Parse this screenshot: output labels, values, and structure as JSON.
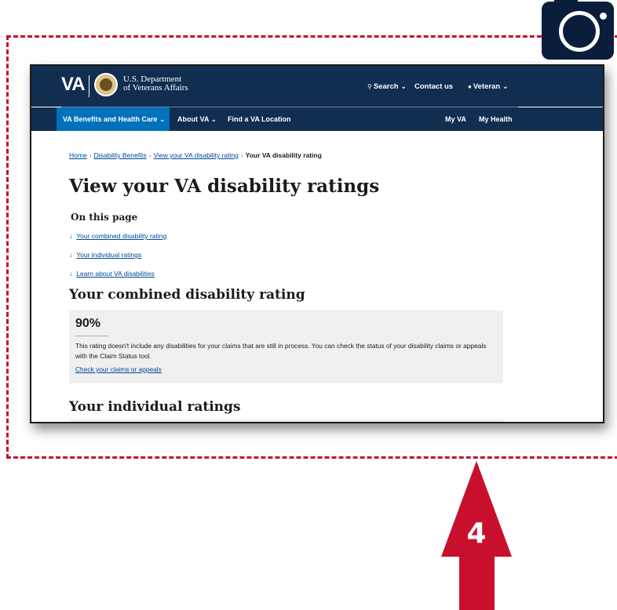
{
  "header": {
    "logo": "VA",
    "dept_line1": "U.S. Department",
    "dept_line2": "of Veterans Affairs",
    "search": "Search",
    "contact": "Contact us",
    "user": "Veteran"
  },
  "nav": {
    "benefits": "VA Benefits and Health Care",
    "about": "About VA",
    "find": "Find a VA Location",
    "myva": "My VA",
    "myhealth": "My Health"
  },
  "breadcrumbs": [
    "Home",
    "Disability Benefits",
    "View your VA disability rating",
    "Your VA disability rating"
  ],
  "page": {
    "title": "View your VA disability ratings",
    "on_this_page": "On this page",
    "jump_links": [
      "Your combined disability rating",
      "Your individual ratings",
      "Learn about VA disabilities"
    ],
    "combined_heading": "Your combined disability rating",
    "individual_heading": "Your individual ratings"
  },
  "rating": {
    "percent": "90%",
    "text": "This rating doesn't include any disabilities for your claims that are still in process. You can check the status of your disability claims or appeals with the Claim Status tool.",
    "link": "Check your claims or appeals"
  },
  "step_badge": "4",
  "icons": {
    "camera": "camera-icon",
    "arrow": "arrow-up-icon",
    "jump": "arrow-down-icon",
    "search": "search-icon",
    "user": "user-icon",
    "chevron": "chevron-down-icon"
  },
  "colors": {
    "header_bg": "#112e51",
    "nav_active": "#0071bb",
    "annotation_red": "#c8102e",
    "link": "#004795"
  }
}
